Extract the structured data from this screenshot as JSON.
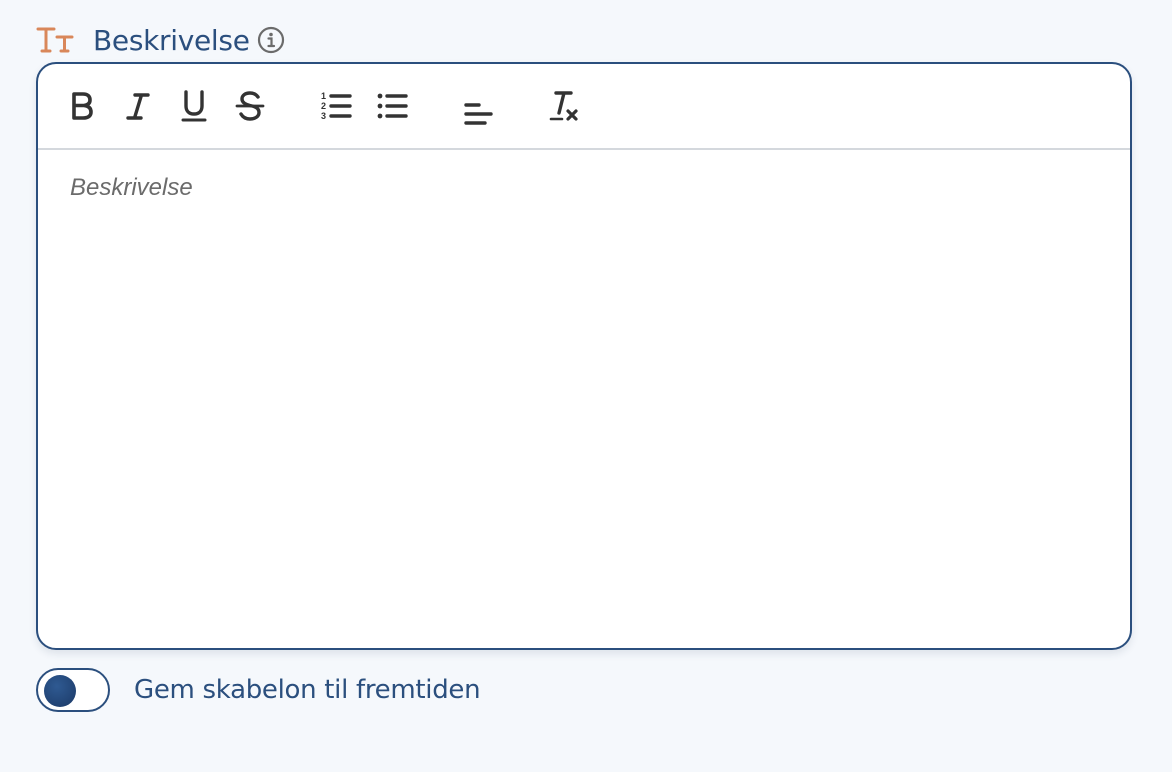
{
  "field": {
    "label": "Beskrivelse",
    "icon": "text-size-icon",
    "info_icon": "info-icon"
  },
  "editor": {
    "toolbar": [
      {
        "name": "bold",
        "icon": "bold-icon"
      },
      {
        "name": "italic",
        "icon": "italic-icon"
      },
      {
        "name": "underline",
        "icon": "underline-icon"
      },
      {
        "name": "strikethrough",
        "icon": "strikethrough-icon"
      },
      {
        "name": "ordered-list",
        "icon": "ordered-list-icon"
      },
      {
        "name": "bullet-list",
        "icon": "bullet-list-icon"
      },
      {
        "name": "align",
        "icon": "align-left-icon"
      },
      {
        "name": "clear-format",
        "icon": "clear-format-icon"
      }
    ],
    "placeholder": "Beskrivelse"
  },
  "save_template": {
    "label": "Gem skabelon til fremtiden",
    "enabled": false
  },
  "colors": {
    "accent": "#2b4f7e",
    "icon_orange": "#d9875a",
    "toolbar_icon": "#333333",
    "background": "#f5f8fc"
  }
}
